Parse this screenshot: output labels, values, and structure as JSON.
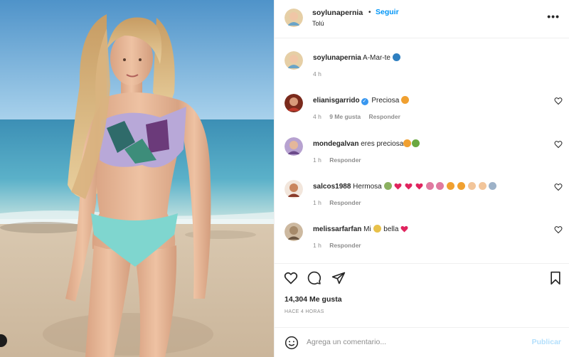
{
  "post": {
    "username": "soylunapernia",
    "separator": "•",
    "follow_label": "Seguir",
    "location": "Tolú",
    "more_label": "•••",
    "caption": "A-Mar-te",
    "caption_time": "4 h"
  },
  "comments": [
    {
      "username": "elianisgarrido",
      "verified": true,
      "text": "Preciosa",
      "time": "4 h",
      "likes": "9 Me gusta",
      "reply": "Responder",
      "avatar_color": "#7a2a1c"
    },
    {
      "username": "mondegalvan",
      "verified": false,
      "text": "eres preciosa",
      "time": "1 h",
      "likes": "",
      "reply": "Responder",
      "avatar_color": "#6b4a8a"
    },
    {
      "username": "salcos1988",
      "verified": false,
      "text": "Hermosa",
      "time": "1 h",
      "likes": "",
      "reply": "Responder",
      "avatar_color": "#8a3a2a"
    },
    {
      "username": "melissarfarfan",
      "verified": false,
      "text_before": "Mi",
      "text_after": "bella",
      "time": "1 h",
      "likes": "",
      "reply": "Responder",
      "avatar_color": "#a68a6a"
    }
  ],
  "actions": {
    "like_icon": "heart-icon",
    "comment_icon": "comment-icon",
    "share_icon": "share-icon",
    "save_icon": "bookmark-icon",
    "likes_count": "14,304 Me gusta",
    "posted_ago": "HACE 4 HORAS"
  },
  "composer": {
    "placeholder": "Agrega un comentario...",
    "publish_label": "Publicar",
    "emoji_icon": "smiley-icon"
  },
  "colors": {
    "link_blue": "#0095f6",
    "publish_disabled": "#b2dffc",
    "muted_text": "#8e8e8e",
    "text": "#262626",
    "divider": "#efefef"
  }
}
